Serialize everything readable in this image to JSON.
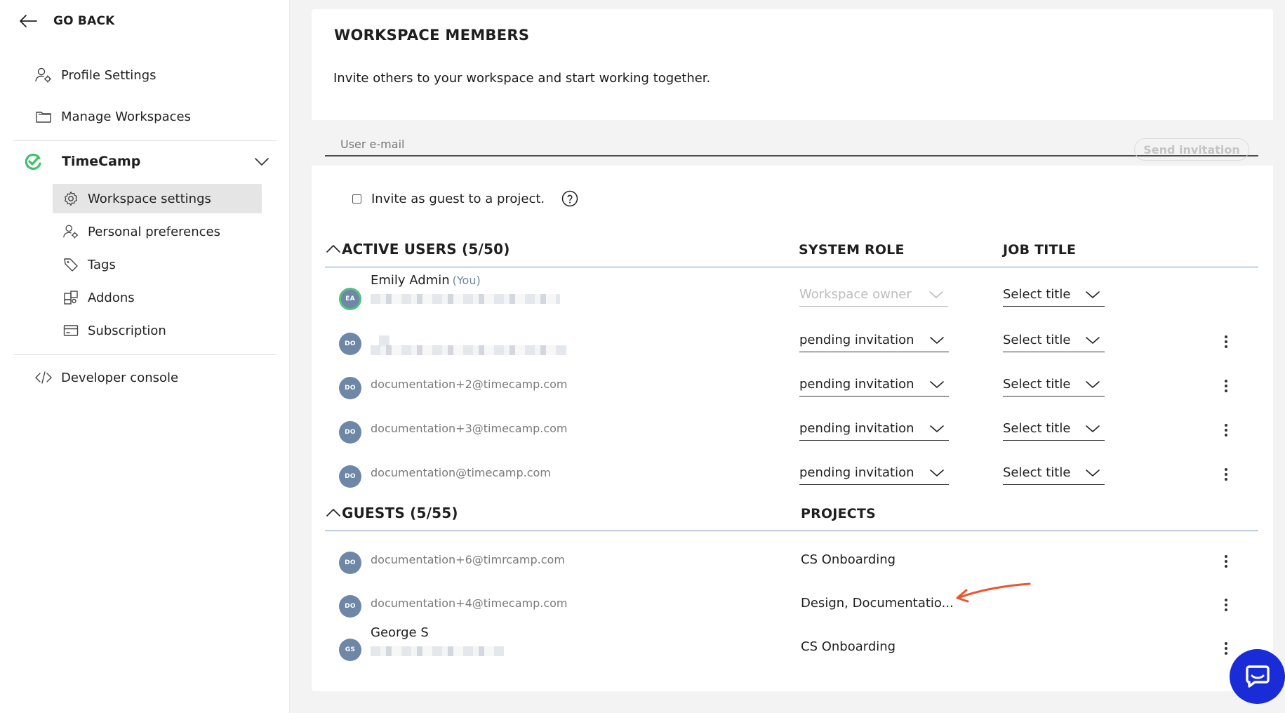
{
  "sidebar": {
    "go_back": "GO BACK",
    "top_items": [
      {
        "label": "Profile Settings",
        "icon": "user-gear-icon"
      },
      {
        "label": "Manage Workspaces",
        "icon": "folder-icon"
      }
    ],
    "workspace": {
      "name": "TimeCamp",
      "icon": "timecamp-logo-icon",
      "logo_color": "#3ec36b"
    },
    "sub_items": [
      {
        "label": "Workspace settings",
        "icon": "gear-icon",
        "active": true
      },
      {
        "label": "Personal preferences",
        "icon": "user-gear-icon"
      },
      {
        "label": "Tags",
        "icon": "tag-icon"
      },
      {
        "label": "Addons",
        "icon": "puzzle-icon"
      },
      {
        "label": "Subscription",
        "icon": "credit-card-icon"
      }
    ],
    "developer_console": "Developer console"
  },
  "main": {
    "title": "WORKSPACE MEMBERS",
    "subtitle": "Invite others to your workspace and start working together.",
    "invite": {
      "placeholder": "User e-mail",
      "send_label": "Send invitation"
    },
    "guest_checkbox_label": "Invite as guest to a project.",
    "active_users": {
      "heading": "ACTIVE USERS (5/50)",
      "role_col": "SYSTEM ROLE",
      "title_col": "JOB TITLE",
      "rows": [
        {
          "initials": "EA",
          "name": "Emily Admin",
          "you": "(You)",
          "email": "",
          "role": "Workspace owner",
          "job_title": "Select title"
        },
        {
          "initials": "DO",
          "name": "",
          "email": "",
          "role": "pending invitation",
          "job_title": "Select title"
        },
        {
          "initials": "DO",
          "name": "",
          "email": "documentation+2@timecamp.com",
          "role": "pending invitation",
          "job_title": "Select title"
        },
        {
          "initials": "DO",
          "name": "",
          "email": "documentation+3@timecamp.com",
          "role": "pending invitation",
          "job_title": "Select title"
        },
        {
          "initials": "DO",
          "name": "",
          "email": "documentation@timecamp.com",
          "role": "pending invitation",
          "job_title": "Select title"
        }
      ]
    },
    "guests": {
      "heading": "GUESTS (5/55)",
      "projects_col": "PROJECTS",
      "rows": [
        {
          "initials": "DO",
          "name": "",
          "email": "documentation+6@timrcamp.com",
          "projects": "CS Onboarding"
        },
        {
          "initials": "DO",
          "name": "",
          "email": "documentation+4@timecamp.com",
          "projects": "Design, Documentatio..."
        },
        {
          "initials": "GS",
          "name": "George S",
          "email": "",
          "projects": "CS Onboarding"
        }
      ]
    }
  },
  "colors": {
    "accent_line": "#6c93ba",
    "avatar": "#6e87a7",
    "chat": "#1a2bd8",
    "annotation_arrow": "#e9552f"
  }
}
